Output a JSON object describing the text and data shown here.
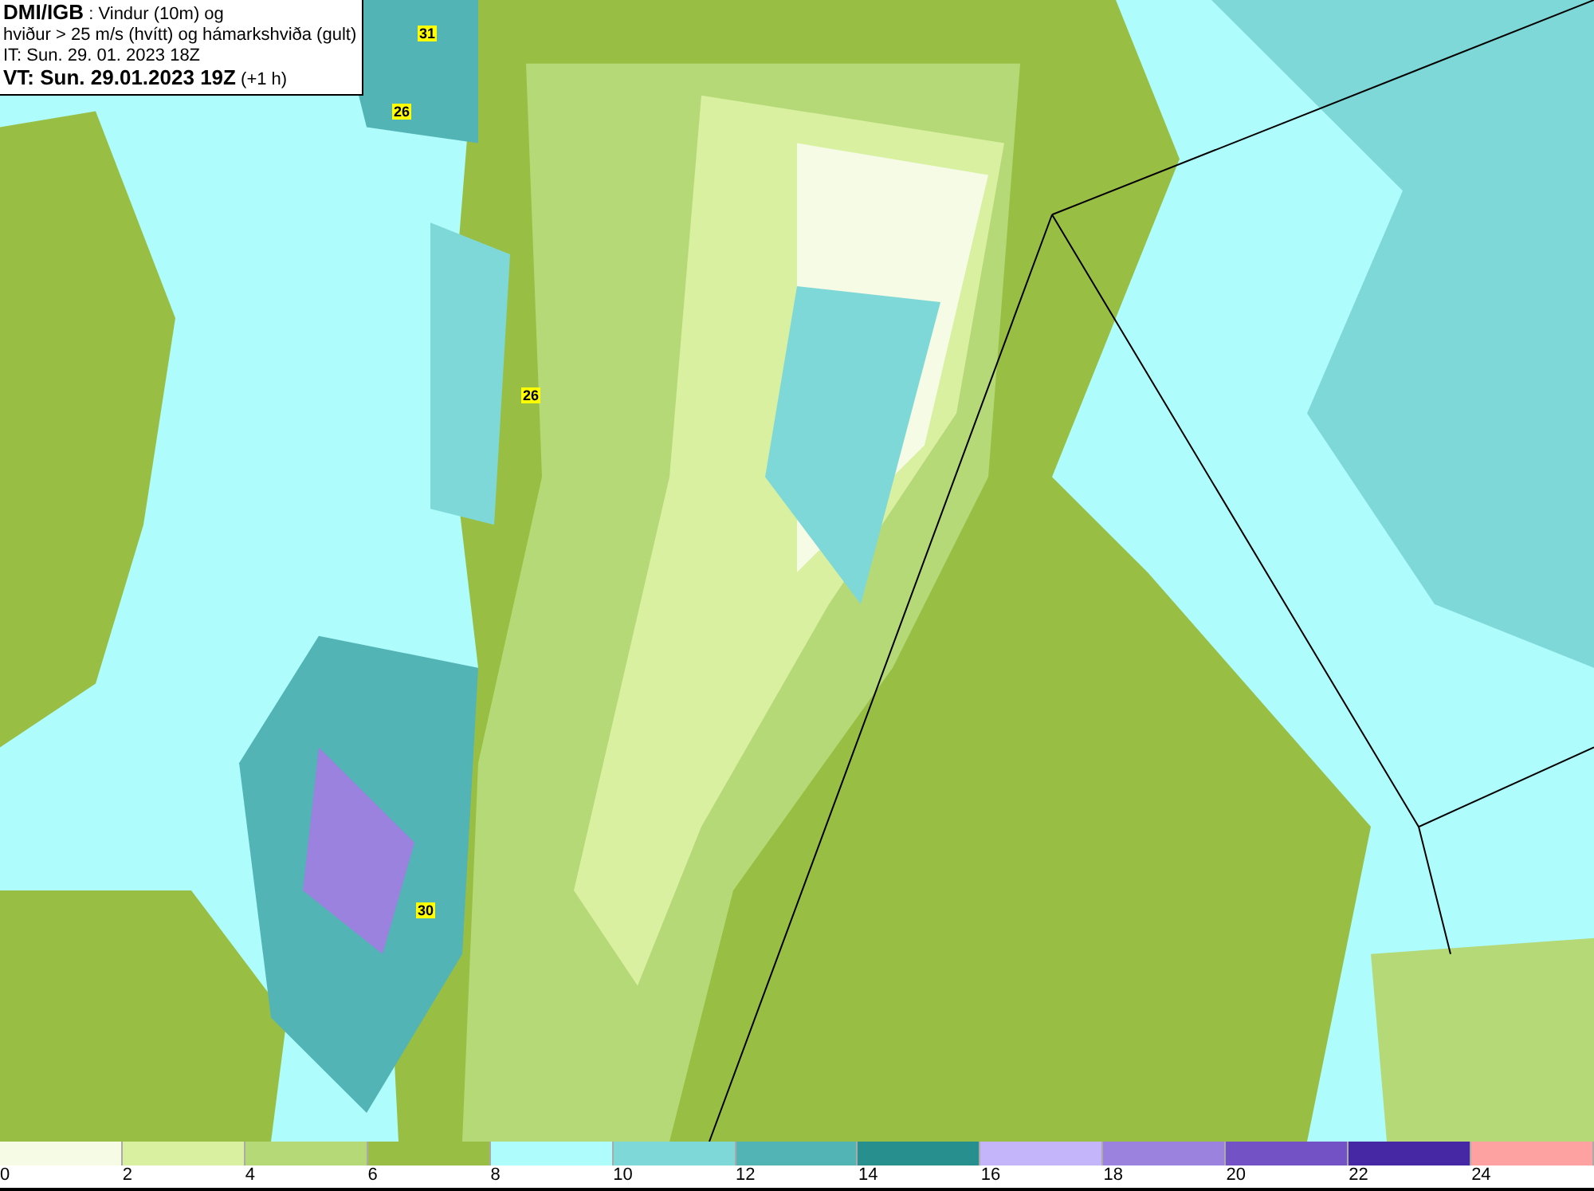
{
  "title_box": {
    "lines": [
      "**DMI/IGB** : Vindur (10m) og",
      "hviður > 25 m/s (hvítt) og hámarkshviða (gult)",
      "IT: Sun. 29. 01. 2023 18Z",
      "**VT: Sun. 29.01.2023 19Z** (+1 h)"
    ]
  },
  "gust_labels": [
    "31",
    "26",
    "26",
    "30"
  ],
  "legend": {
    "segments": [
      {
        "label": "0",
        "color": "#f5fbe4"
      },
      {
        "label": "2",
        "color": "#d8f0a0"
      },
      {
        "label": "4",
        "color": "#b5d977"
      },
      {
        "label": "6",
        "color": "#98bf44"
      },
      {
        "label": "8",
        "color": "#aefcfc"
      },
      {
        "label": "10",
        "color": "#7fd8d8"
      },
      {
        "label": "12",
        "color": "#52b4b4"
      },
      {
        "label": "14",
        "color": "#27908f"
      },
      {
        "label": "16",
        "color": "#c4b5fb"
      },
      {
        "label": "18",
        "color": "#9a82de"
      },
      {
        "label": "20",
        "color": "#7252c4"
      },
      {
        "label": "22",
        "color": "#4628a4"
      },
      {
        "label": "24",
        "color": "#fda2a0"
      }
    ]
  }
}
